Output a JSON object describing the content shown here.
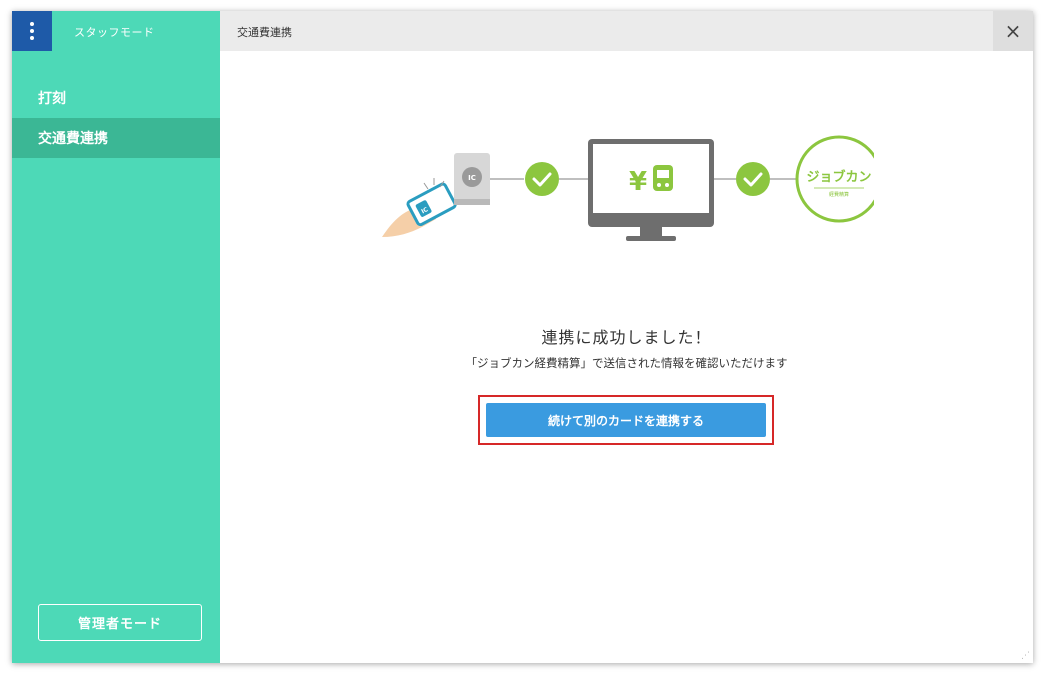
{
  "sidebar": {
    "mode_title": "スタッフモード",
    "items": [
      {
        "label": "打刻",
        "active": false
      },
      {
        "label": "交通費連携",
        "active": true
      }
    ],
    "admin_button": "管理者モード"
  },
  "header": {
    "title": "交通費連携",
    "close_icon": "×"
  },
  "illustration": {
    "reader_label": "IC",
    "card_label": "IC",
    "screen_text": "¥",
    "brand_name": "ジョブカン",
    "brand_sub": "経費精算"
  },
  "main": {
    "success_title": "連携に成功しました！",
    "success_desc": "「ジョブカン経費精算」で送信された情報を確認いただけます",
    "continue_button": "続けて別のカードを連携する"
  },
  "colors": {
    "sidebar": "#4dd9b7",
    "sidebar_active": "#3bb795",
    "menu_button": "#1e5aa8",
    "primary": "#3a9be0",
    "check": "#8cc63f",
    "highlight": "#d62828"
  }
}
